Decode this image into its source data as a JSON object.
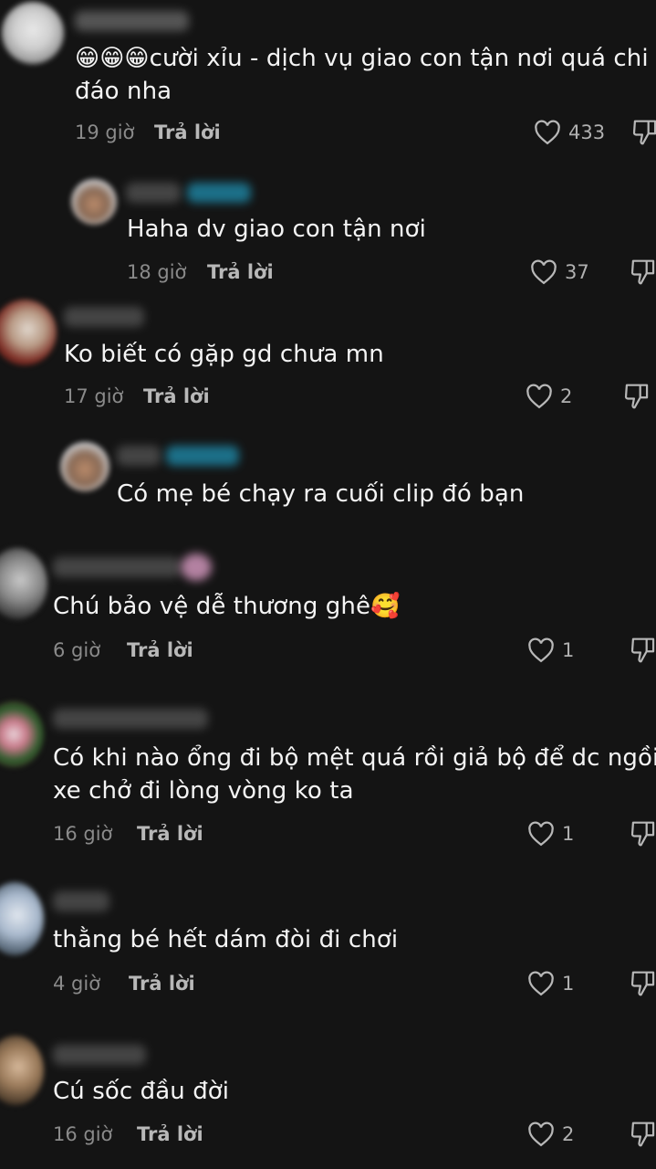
{
  "comments": [
    {
      "emojis": "😁😁😁",
      "text": "cười xỉu - dịch vụ giao con tận nơi quá chi",
      "text2": "đáo nha",
      "time": "19 giờ",
      "reply": "Trả lời",
      "likes": "433"
    },
    {
      "text": "Haha dv giao con tận nơi",
      "time": "18 giờ",
      "reply": "Trả lời",
      "likes": "37"
    },
    {
      "text": "Ko biết có gặp gd chưa mn",
      "time": "17 giờ",
      "reply": "Trả lời",
      "likes": "2"
    },
    {
      "text": "Có mẹ bé chạy ra cuối clip đó bạn"
    },
    {
      "text": "Chú bảo vệ dễ thương ghê",
      "emoji_end": "🥰",
      "time": "6 giờ",
      "reply": "Trả lời",
      "likes": "1"
    },
    {
      "text": "Có khi nào ổng đi bộ mệt quá rồi giả bộ để dc ngồi",
      "text2": "xe chở đi lòng vòng ko ta",
      "time": "16 giờ",
      "reply": "Trả lời",
      "likes": "1"
    },
    {
      "text": "thằng bé hết dám đòi đi chơi",
      "time": "4 giờ",
      "reply": "Trả lời",
      "likes": "1"
    },
    {
      "text": "Cú sốc đầu đời",
      "time": "16 giờ",
      "reply": "Trả lời",
      "likes": "2"
    }
  ],
  "colors": {
    "background": "#141414",
    "text": "#f4f4f4",
    "meta": "#8a8a8a"
  }
}
